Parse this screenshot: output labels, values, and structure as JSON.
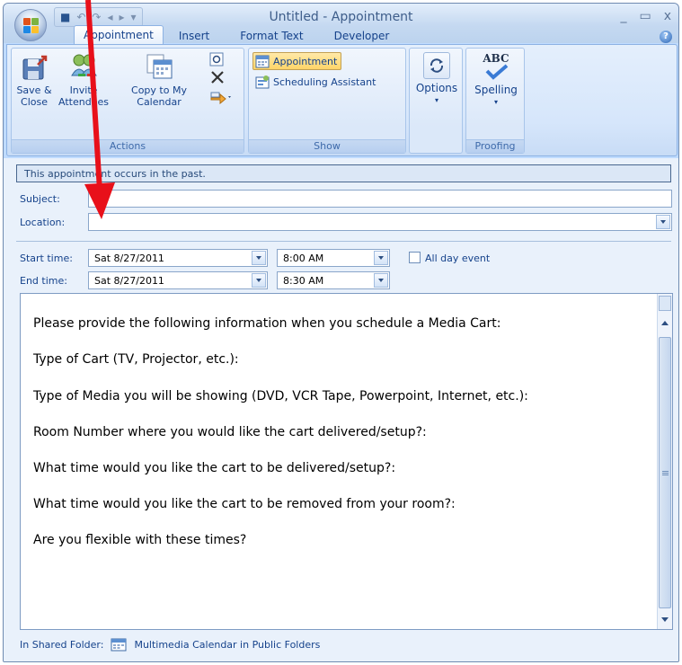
{
  "window": {
    "title": "Untitled - Appointment",
    "minimize": "_",
    "maximize": "▭",
    "close": "x"
  },
  "tabs": [
    "Appointment",
    "Insert",
    "Format Text",
    "Developer"
  ],
  "help": "?",
  "ribbon": {
    "actions": {
      "label": "Actions",
      "save_close": [
        "Save &",
        "Close"
      ],
      "invite": [
        "Invite",
        "Attendees"
      ],
      "copy": [
        "Copy to My",
        "Calendar"
      ]
    },
    "show": {
      "label": "Show",
      "appointment": "Appointment",
      "scheduling": "Scheduling Assistant"
    },
    "options": {
      "label": "Options"
    },
    "proofing": {
      "label": "Proofing",
      "spelling": "Spelling",
      "abc": "ABC"
    }
  },
  "form": {
    "banner": "This appointment occurs in the past.",
    "subject_label": "Subject:",
    "subject_value": "",
    "location_label": "Location:",
    "location_value": "",
    "start_label": "Start time:",
    "start_date": "Sat 8/27/2011",
    "start_time": "8:00 AM",
    "end_label": "End time:",
    "end_date": "Sat 8/27/2011",
    "end_time": "8:30 AM",
    "all_day": "All day event"
  },
  "body_lines": [
    "Please provide the following information when you schedule a Media Cart:",
    "Type of Cart (TV, Projector, etc.):",
    "Type of Media you will be showing (DVD, VCR Tape, Powerpoint, Internet, etc.):",
    "Room Number where you would like the cart delivered/setup?:",
    "What time would you like the cart to be delivered/setup?:",
    "What time would you like the cart to be removed from your room?:",
    "Are you flexible with these times?"
  ],
  "footer": {
    "label": "In Shared Folder:",
    "folder": "Multimedia Calendar in Public Folders"
  },
  "colors": {
    "annotation_arrow": "#e8101a",
    "accent": "#15428b"
  }
}
